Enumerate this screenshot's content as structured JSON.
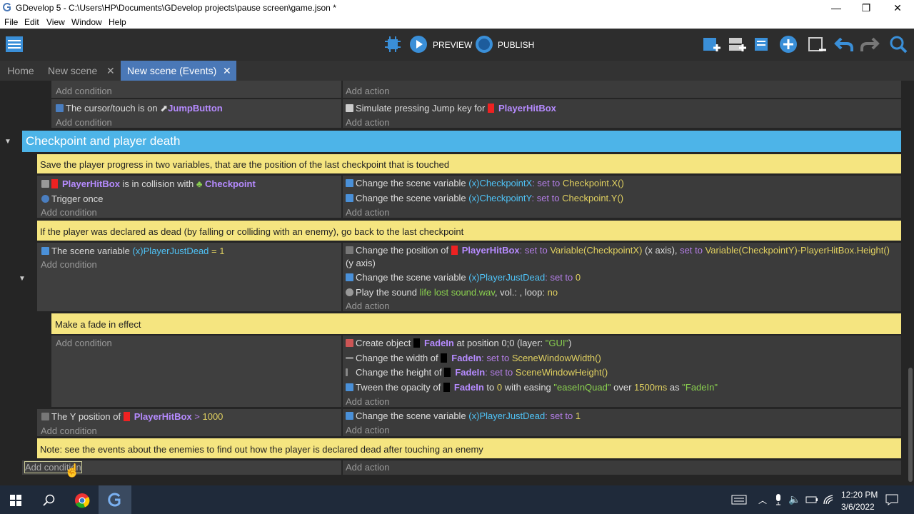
{
  "window": {
    "title": "GDevelop 5 - C:\\Users\\HP\\Documents\\GDevelop projects\\pause screen\\game.json *",
    "minimize": "—",
    "maximize": "❐",
    "close": "✕"
  },
  "menu": [
    "File",
    "Edit",
    "View",
    "Window",
    "Help"
  ],
  "toolbar": {
    "preview_label": "PREVIEW",
    "publish_label": "PUBLISH"
  },
  "tabs": [
    {
      "label": "Home"
    },
    {
      "label": "New scene",
      "close": "✕"
    },
    {
      "label": "New scene (Events)",
      "close": "✕"
    }
  ],
  "events": {
    "add_condition": "Add condition",
    "add_action": "Add action",
    "top": {
      "action_partial": "Simulate pressing ...",
      "cond2_text": "The cursor/touch is on",
      "cond2_obj": "JumpButton",
      "act2_text": "Simulate pressing Jump key for",
      "act2_obj": "PlayerHitBox"
    },
    "group_title": "Checkpoint and player death",
    "comment1": "Save the player progress in two variables, that are the position of the last checkpoint that is touched",
    "e1": {
      "c1_obj": "PlayerHitBox",
      "c1_text": "is in collision with",
      "c1_obj2": "Checkpoint",
      "c2_text": "Trigger once",
      "a1_text": "Change the scene variable",
      "a1_var": "CheckpointX",
      "a1_set": ": set to",
      "a1_val": "Checkpoint.X()",
      "a2_text": "Change the scene variable",
      "a2_var": "CheckpointY",
      "a2_set": ": set to",
      "a2_val": "Checkpoint.Y()"
    },
    "comment2": "If the player was declared as dead (by falling or colliding with an enemy), go back to the last checkpoint",
    "e2": {
      "c1_text": "The scene variable",
      "c1_var": "PlayerJustDead",
      "c1_op": "= 1",
      "a1_text": "Change the position of",
      "a1_obj": "PlayerHitBox",
      "a1_set1": ": set to",
      "a1_val1": "Variable(CheckpointX)",
      "a1_axis1": "(x axis),",
      "a1_set2": "set to",
      "a1_val2": "Variable(CheckpointY)-PlayerHitBox.Height()",
      "a1_axis2": "(y axis)",
      "a2_text": "Change the scene variable",
      "a2_var": "PlayerJustDead",
      "a2_set": ": set to",
      "a2_val": "0",
      "a3_text": "Play the sound",
      "a3_file": "life lost sound.wav",
      "a3_vol": ", vol.: , loop:",
      "a3_loop": "no"
    },
    "comment3": "Make a fade in effect",
    "e3": {
      "a1_text": "Create object",
      "a1_obj": "FadeIn",
      "a1_pos": "at position 0;0 (layer:",
      "a1_layer": "\"GUI\"",
      "a1_end": ")",
      "a2_text": "Change the width of",
      "a2_obj": "FadeIn",
      "a2_set": ": set to",
      "a2_val": "SceneWindowWidth()",
      "a3_text": "Change the height of",
      "a3_obj": "FadeIn",
      "a3_set": ": set to",
      "a3_val": "SceneWindowHeight()",
      "a4_text": "Tween the opacity of",
      "a4_obj": "FadeIn",
      "a4_to": "to",
      "a4_val": "0",
      "a4_ease": "with easing",
      "a4_easing": "\"easeInQuad\"",
      "a4_over": "over",
      "a4_ms": "1500ms",
      "a4_as": "as",
      "a4_id": "\"FadeIn\""
    },
    "e4": {
      "c1_text": "The Y position of",
      "c1_obj": "PlayerHitBox",
      "c1_op": ">",
      "c1_val": "1000",
      "a1_text": "Change the scene variable",
      "a1_var": "PlayerJustDead",
      "a1_set": ": set to",
      "a1_val": "1"
    },
    "comment4": "Note: see the events about the enemies to find out how the player is declared dead after touching an enemy"
  },
  "taskbar": {
    "time": "12:20 PM",
    "date": "3/6/2022"
  },
  "colors": {
    "group": "#4db4e8",
    "comment": "#f5e580",
    "tab_active": "#4a78b7",
    "object": "#b68bff",
    "variable": "#4fc3f7",
    "value": "#e0d060",
    "string": "#8ad04f"
  }
}
